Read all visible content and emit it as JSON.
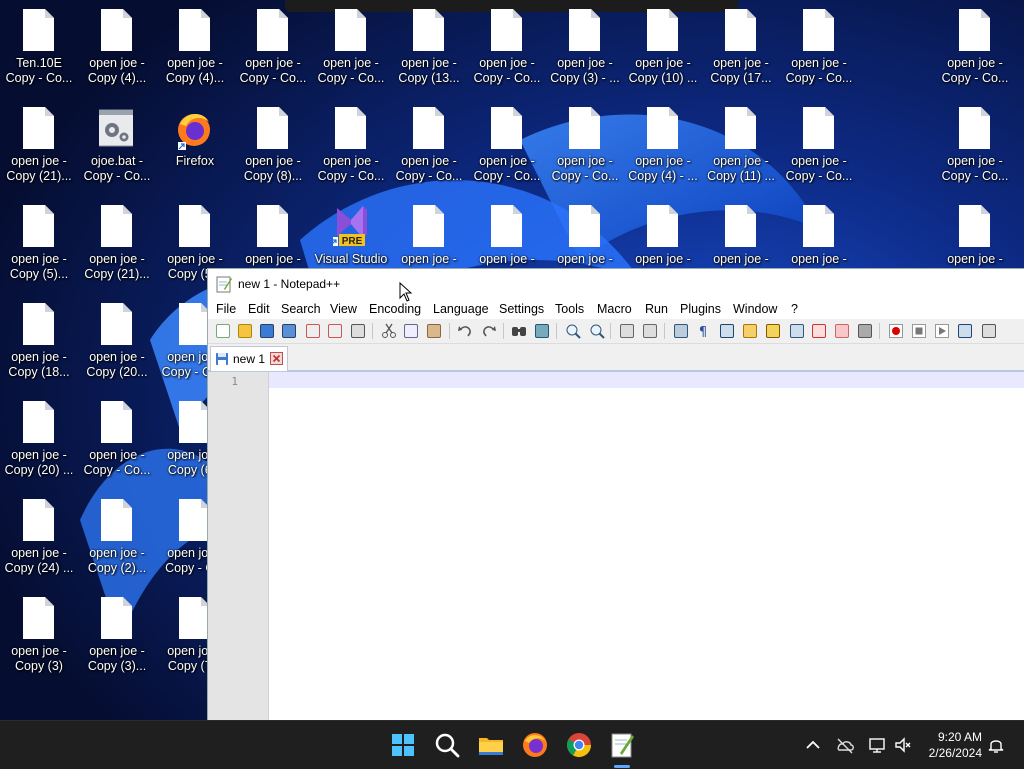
{
  "desktop": {
    "icons": [
      {
        "label": "Ten.10E\nCopy - Co...",
        "icon": "file-icon"
      },
      {
        "label": "open joe -\nCopy (4)...",
        "icon": "file-icon"
      },
      {
        "label": "open joe -\nCopy (4)...",
        "icon": "file-icon"
      },
      {
        "label": "open joe -\nCopy - Co...",
        "icon": "file-icon"
      },
      {
        "label": "open joe -\nCopy - Co...",
        "icon": "file-icon"
      },
      {
        "label": "open joe -\nCopy (13...",
        "icon": "file-icon"
      },
      {
        "label": "open joe -\nCopy - Co...",
        "icon": "file-icon"
      },
      {
        "label": "open joe -\nCopy (3) - ...",
        "icon": "file-icon"
      },
      {
        "label": "open joe -\nCopy (10) ...",
        "icon": "file-icon"
      },
      {
        "label": "open joe -\nCopy (17...",
        "icon": "file-icon"
      },
      {
        "label": "open joe -\nCopy - Co...",
        "icon": "file-icon"
      },
      {
        "label": "open joe -\nCopy - Co...",
        "icon": "file-icon"
      },
      {
        "label": "open joe -\nCopy (21)...",
        "icon": "file-icon"
      },
      {
        "label": "ojoe.bat -\nCopy - Co...",
        "icon": "gear-file-icon"
      },
      {
        "label": "Firefox",
        "icon": "firefox-icon"
      },
      {
        "label": "open joe -\nCopy (8)...",
        "icon": "file-icon"
      },
      {
        "label": "open joe -\nCopy - Co...",
        "icon": "file-icon"
      },
      {
        "label": "open joe -\nCopy - Co...",
        "icon": "file-icon"
      },
      {
        "label": "open joe -\nCopy - Co...",
        "icon": "file-icon"
      },
      {
        "label": "open joe -\nCopy - Co...",
        "icon": "file-icon"
      },
      {
        "label": "open joe -\nCopy (4) - ...",
        "icon": "file-icon"
      },
      {
        "label": "open joe -\nCopy (11) ...",
        "icon": "file-icon"
      },
      {
        "label": "open joe -\nCopy - Co...",
        "icon": "file-icon"
      },
      {
        "label": "open joe -\nCopy - Co...",
        "icon": "file-icon"
      },
      {
        "label": "open joe -\nCopy (5)...",
        "icon": "file-icon"
      },
      {
        "label": "open joe -\nCopy (21)...",
        "icon": "file-icon"
      },
      {
        "label": "open joe -\nCopy (5...",
        "icon": "file-icon"
      },
      {
        "label": "open joe -\n",
        "icon": "file-icon"
      },
      {
        "label": "Visual Studio\n",
        "icon": "visual-studio-icon"
      },
      {
        "label": "open joe -\n",
        "icon": "file-icon"
      },
      {
        "label": "open joe -\n",
        "icon": "file-icon"
      },
      {
        "label": "open joe -\n",
        "icon": "file-icon"
      },
      {
        "label": "open joe -\n",
        "icon": "file-icon"
      },
      {
        "label": "open joe -\n",
        "icon": "file-icon"
      },
      {
        "label": "open joe -\n",
        "icon": "file-icon"
      },
      {
        "label": "open joe -\n",
        "icon": "file-icon"
      },
      {
        "label": "open joe -\nCopy (18...",
        "icon": "file-icon"
      },
      {
        "label": "open joe -\nCopy (20...",
        "icon": "file-icon"
      },
      {
        "label": "open joe -\nCopy - Co...",
        "icon": "file-icon"
      },
      {
        "label": "open joe -\nCopy (20) ...",
        "icon": "file-icon"
      },
      {
        "label": "open joe -\nCopy - Co...",
        "icon": "file-icon"
      },
      {
        "label": "open joe -\nCopy (6...",
        "icon": "file-icon"
      },
      {
        "label": "open joe -\nCopy (24) ...",
        "icon": "file-icon"
      },
      {
        "label": "open joe -\nCopy (2)...",
        "icon": "file-icon"
      },
      {
        "label": "open joe -\nCopy - C...",
        "icon": "file-icon"
      },
      {
        "label": "open joe -\nCopy (3)",
        "icon": "file-icon"
      },
      {
        "label": "open joe -\nCopy (3)...",
        "icon": "file-icon"
      },
      {
        "label": "open joe -\nCopy (7...",
        "icon": "file-icon"
      }
    ]
  },
  "notepad": {
    "title": "new 1 - Notepad++",
    "menu": [
      "File",
      "Edit",
      "Search",
      "View",
      "Encoding",
      "Language",
      "Settings",
      "Tools",
      "Macro",
      "Run",
      "Plugins",
      "Window",
      "?"
    ],
    "tab_label": "new 1",
    "line_number": "1",
    "badge_pre": "PRE"
  },
  "taskbar": {
    "time": "9:20 AM",
    "date": "2/26/2024",
    "apps": [
      "start-icon",
      "search-icon",
      "file-explorer-icon",
      "firefox-icon",
      "chrome-icon",
      "notepad-plus-plus-icon"
    ]
  },
  "colors": {
    "accent": "#5ca8ff",
    "taskbar_bg": "#1f1f1f",
    "wallpaper_deep": "#0a1a4a",
    "wallpaper_bloom": "#1e6cf0"
  }
}
